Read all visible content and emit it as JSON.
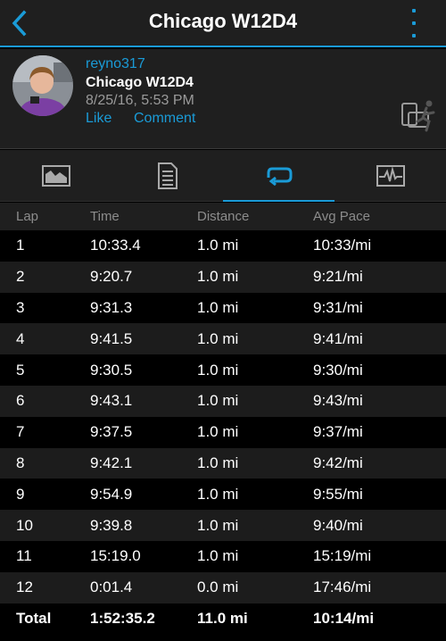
{
  "header": {
    "title": "Chicago W12D4",
    "accent_color": "#1a9bd7",
    "back_icon": "chevron-left-icon",
    "more_icon": "vertical-ellipsis-icon"
  },
  "activity": {
    "username": "reyno317",
    "name": "Chicago W12D4",
    "datetime": "8/25/16, 5:53 PM",
    "like_label": "Like",
    "comment_label": "Comment",
    "device_icon": "device-sync-icon"
  },
  "tabs": [
    {
      "icon": "chart-icon",
      "active": false
    },
    {
      "icon": "document-icon",
      "active": false
    },
    {
      "icon": "laps-icon",
      "active": true
    },
    {
      "icon": "heart-rate-icon",
      "active": false
    }
  ],
  "laps_table": {
    "headers": [
      "Lap",
      "Time",
      "Distance",
      "Avg Pace"
    ],
    "rows": [
      [
        "1",
        "10:33.4",
        "1.0 mi",
        "10:33/mi"
      ],
      [
        "2",
        "9:20.7",
        "1.0 mi",
        "9:21/mi"
      ],
      [
        "3",
        "9:31.3",
        "1.0 mi",
        "9:31/mi"
      ],
      [
        "4",
        "9:41.5",
        "1.0 mi",
        "9:41/mi"
      ],
      [
        "5",
        "9:30.5",
        "1.0 mi",
        "9:30/mi"
      ],
      [
        "6",
        "9:43.1",
        "1.0 mi",
        "9:43/mi"
      ],
      [
        "7",
        "9:37.5",
        "1.0 mi",
        "9:37/mi"
      ],
      [
        "8",
        "9:42.1",
        "1.0 mi",
        "9:42/mi"
      ],
      [
        "9",
        "9:54.9",
        "1.0 mi",
        "9:55/mi"
      ],
      [
        "10",
        "9:39.8",
        "1.0 mi",
        "9:40/mi"
      ],
      [
        "11",
        "15:19.0",
        "1.0 mi",
        "15:19/mi"
      ],
      [
        "12",
        "0:01.4",
        "0.0 mi",
        "17:46/mi"
      ]
    ],
    "total": [
      "Total",
      "1:52:35.2",
      "11.0 mi",
      "10:14/mi"
    ]
  }
}
